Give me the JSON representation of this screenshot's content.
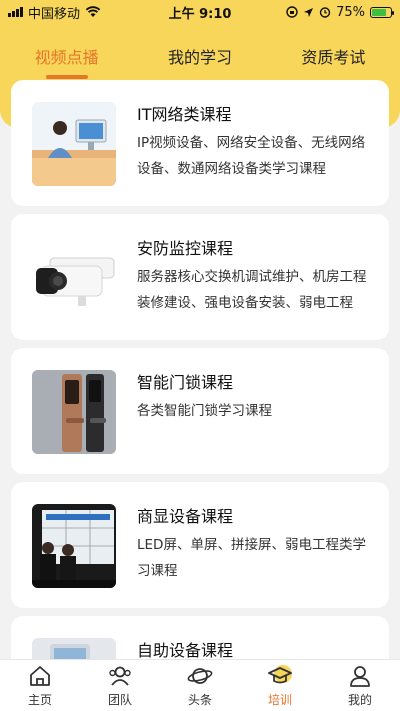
{
  "status_bar": {
    "carrier": "中国移动",
    "time": "上午 9:10",
    "battery": "75%",
    "battery_level": 0.75
  },
  "top_tabs": [
    {
      "label": "视频点播",
      "active": true
    },
    {
      "label": "我的学习",
      "active": false
    },
    {
      "label": "资质考试",
      "active": false
    }
  ],
  "courses": [
    {
      "title": "IT网络类课程",
      "desc": "IP视频设备、网络安全设备、无线网络设备、数通网络设备类学习课程",
      "image_icon": "computer-training-photo"
    },
    {
      "title": "安防监控课程",
      "desc": "服务器核心交换机调试维护、机房工程装修建设、强电设备安装、弱电工程",
      "image_icon": "security-camera-photo"
    },
    {
      "title": "智能门锁课程",
      "desc": "各类智能门锁学习课程",
      "image_icon": "smart-door-lock-photo"
    },
    {
      "title": "商显设备课程",
      "desc": "LED屏、单屏、拼接屏、弱电工程类学习课程",
      "image_icon": "display-screen-photo"
    },
    {
      "title": "自助设备课程",
      "desc": "",
      "image_icon": "self-service-device-photo"
    }
  ],
  "bottom_nav": [
    {
      "label": "主页",
      "icon": "home-icon",
      "active": false
    },
    {
      "label": "团队",
      "icon": "team-icon",
      "active": false
    },
    {
      "label": "头条",
      "icon": "planet-icon",
      "active": false
    },
    {
      "label": "培训",
      "icon": "graduation-cap-icon",
      "active": true
    },
    {
      "label": "我的",
      "icon": "user-icon",
      "active": false
    }
  ],
  "colors": {
    "header_bg": "#f7d65a",
    "accent": "#e6762a"
  }
}
